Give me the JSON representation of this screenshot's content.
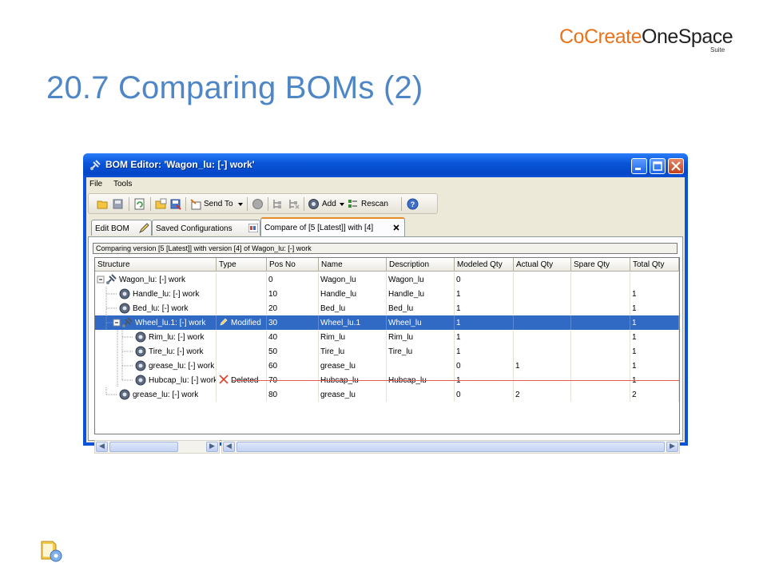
{
  "slide": {
    "title": "20.7 Comparing BOMs (2)",
    "brand_part1": "CoCreate",
    "brand_part2": "OneSpace",
    "brand_suite": "Suite"
  },
  "window": {
    "title": "BOM Editor: 'Wagon_lu: [-] work'",
    "menu": [
      {
        "label": "File"
      },
      {
        "label": "Tools"
      }
    ],
    "toolbar": {
      "send_to_label": "Send To",
      "add_label": "Add",
      "rescan_label": "Rescan"
    },
    "tabs": [
      {
        "label": "Edit BOM"
      },
      {
        "label": "Saved Configurations"
      },
      {
        "label": "Compare of [5 [Latest]] with [4]"
      }
    ],
    "compare_info": "Comparing version [5 [Latest]] with version [4] of Wagon_lu: [-] work"
  },
  "table": {
    "columns": [
      "Structure",
      "Type",
      "Pos No",
      "Name",
      "Description",
      "Modeled Qty",
      "Actual Qty",
      "Spare Qty",
      "Total Qty"
    ],
    "rows": [
      {
        "structure": "Wagon_lu: [-] work",
        "type": "",
        "pos": "0",
        "name": "Wagon_lu",
        "desc": "Wagon_lu",
        "modeled": "0",
        "actual": "",
        "spare": "",
        "total": ""
      },
      {
        "structure": "Handle_lu: [-] work",
        "type": "",
        "pos": "10",
        "name": "Handle_lu",
        "desc": "Handle_lu",
        "modeled": "1",
        "actual": "",
        "spare": "",
        "total": "1"
      },
      {
        "structure": "Bed_lu: [-] work",
        "type": "",
        "pos": "20",
        "name": "Bed_lu",
        "desc": "Bed_lu",
        "modeled": "1",
        "actual": "",
        "spare": "",
        "total": "1"
      },
      {
        "structure": "Wheel_lu.1: [-] work",
        "type": "Modified",
        "pos": "30",
        "name": "Wheel_lu.1",
        "desc": "Wheel_lu",
        "modeled": "1",
        "actual": "",
        "spare": "",
        "total": "1"
      },
      {
        "structure": "Rim_lu: [-] work",
        "type": "",
        "pos": "40",
        "name": "Rim_lu",
        "desc": "Rim_lu",
        "modeled": "1",
        "actual": "",
        "spare": "",
        "total": "1"
      },
      {
        "structure": "Tire_lu: [-] work",
        "type": "",
        "pos": "50",
        "name": "Tire_lu",
        "desc": "Tire_lu",
        "modeled": "1",
        "actual": "",
        "spare": "",
        "total": "1"
      },
      {
        "structure": "grease_lu: [-] work",
        "type": "",
        "pos": "60",
        "name": "grease_lu",
        "desc": "",
        "modeled": "0",
        "actual": "1",
        "spare": "",
        "total": "1"
      },
      {
        "structure": "Hubcap_lu: [-] work",
        "type": "Deleted",
        "pos": "70",
        "name": "Hubcap_lu",
        "desc": "Hubcap_lu",
        "modeled": "1",
        "actual": "",
        "spare": "",
        "total": "1"
      },
      {
        "structure": "grease_lu: [-] work",
        "type": "",
        "pos": "80",
        "name": "grease_lu",
        "desc": "",
        "modeled": "0",
        "actual": "2",
        "spare": "",
        "total": "2"
      }
    ]
  },
  "colors": {
    "slide_title": "#4f86c6",
    "brand_orange": "#e8731c",
    "selection": "#316ac5",
    "deleted_mark": "#d9432b"
  }
}
